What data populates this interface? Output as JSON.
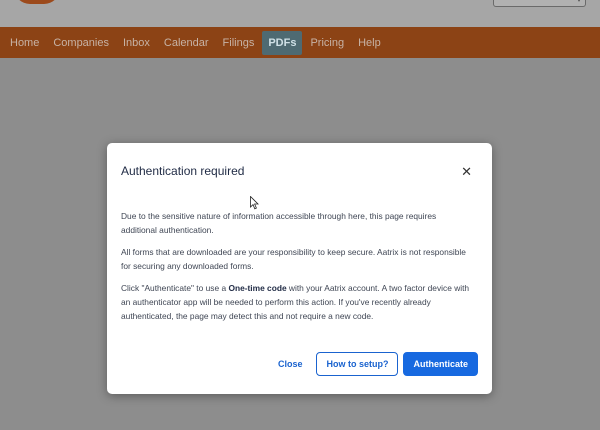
{
  "nav": {
    "items": [
      {
        "label": "Home"
      },
      {
        "label": "Companies"
      },
      {
        "label": "Inbox"
      },
      {
        "label": "Calendar"
      },
      {
        "label": "Filings"
      },
      {
        "label": "PDFs",
        "active": true
      },
      {
        "label": "Pricing"
      },
      {
        "label": "Help"
      }
    ]
  },
  "modal": {
    "title": "Authentication required",
    "close_icon": "close-icon",
    "paragraph1": "Due to the sensitive nature of information accessible through here, this page requires additional authentication.",
    "paragraph2": "All forms that are downloaded are your responsibility to keep secure. Aatrix is not responsible for securing any downloaded forms.",
    "paragraph3_before": "Click \"Authenticate\" to use a ",
    "paragraph3_bold": "One-time code",
    "paragraph3_after": " with your Aatrix account. A two factor device with an authenticator app will be needed to perform this action. If you've recently already authenticated, the page may detect this and not require a new code.",
    "close_label": "Close",
    "setup_label": "How to setup?",
    "authenticate_label": "Authenticate"
  },
  "colors": {
    "nav_bg": "#8c4315",
    "primary": "#1769e0",
    "overlay": "#8d8d8d"
  }
}
